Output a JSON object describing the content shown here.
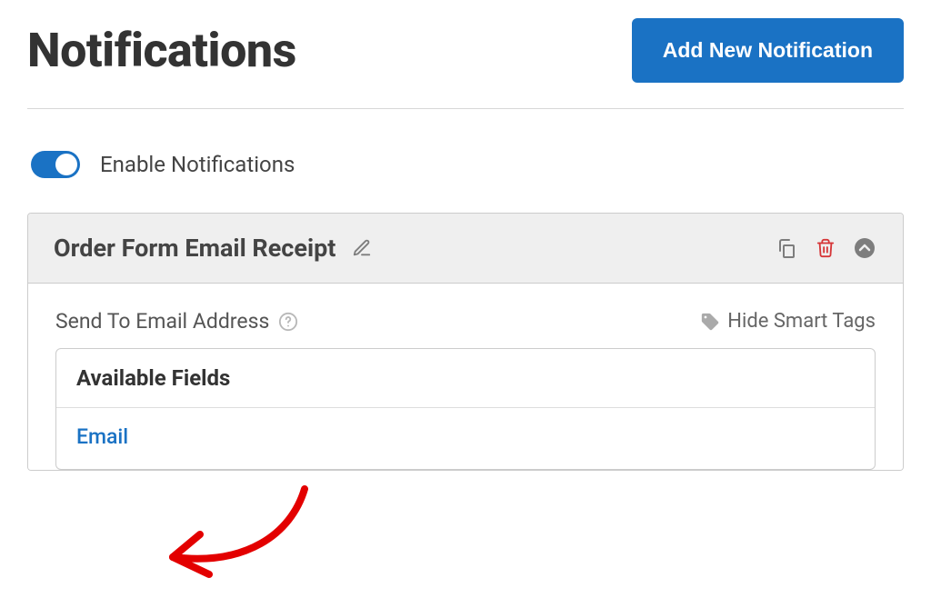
{
  "header": {
    "title": "Notifications",
    "add_button": "Add New Notification"
  },
  "enable": {
    "label": "Enable Notifications"
  },
  "notification": {
    "title": "Order Form Email Receipt",
    "send_to_label": "Send To Email Address",
    "hide_smart_tags": "Hide Smart Tags",
    "available_fields_header": "Available Fields",
    "field_email": "Email"
  }
}
